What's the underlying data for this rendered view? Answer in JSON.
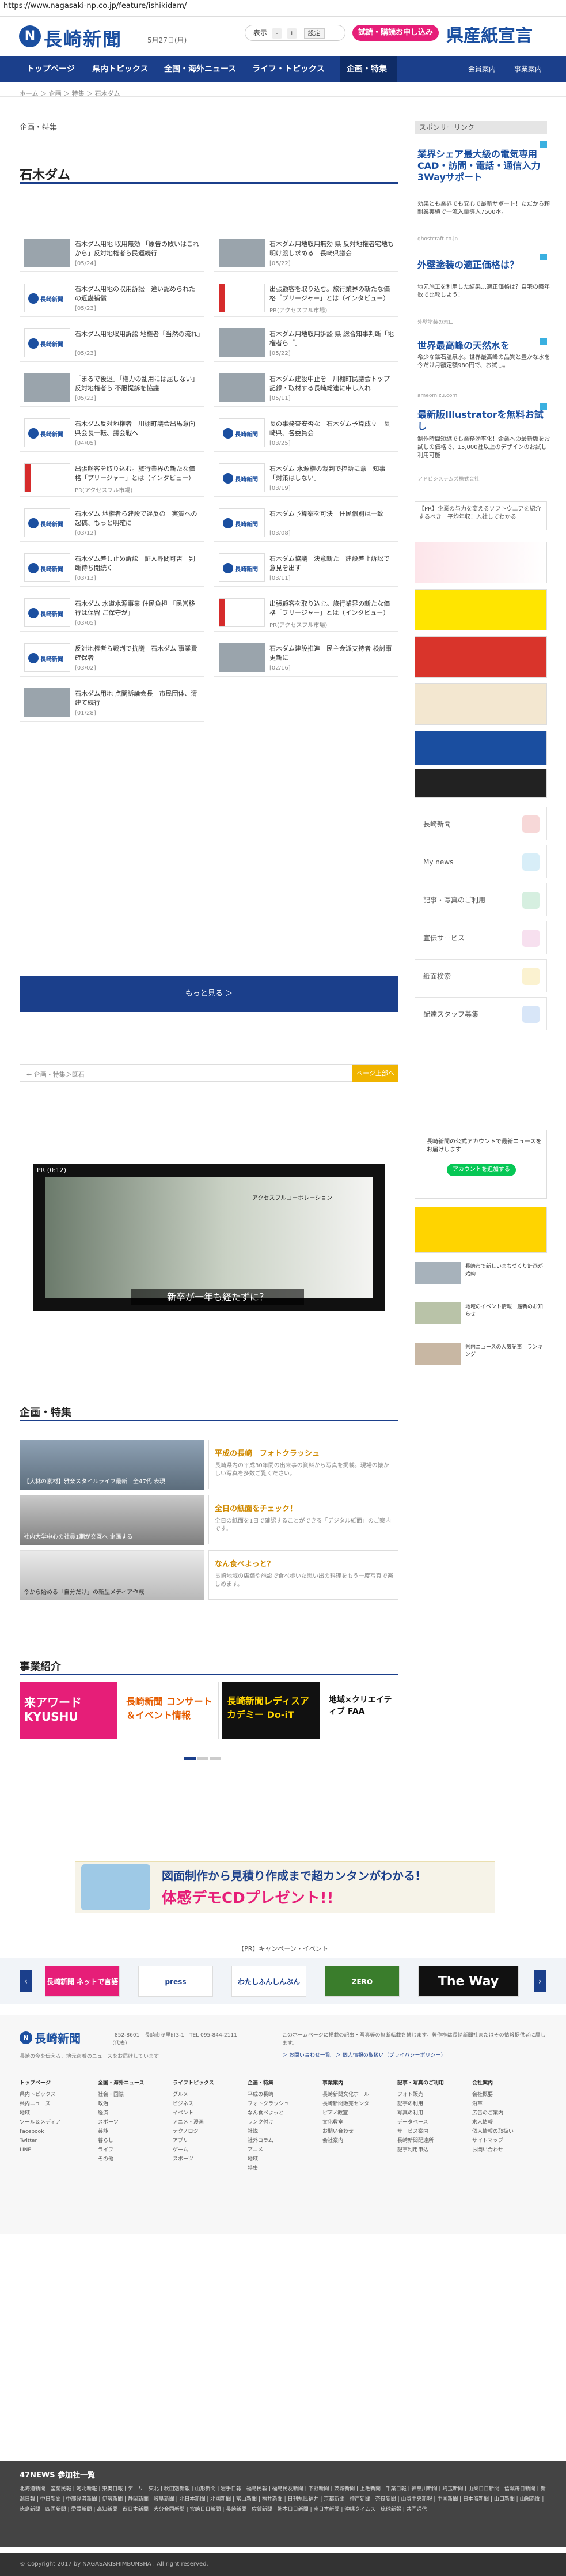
{
  "browser": {
    "url": "https://www.nagasaki-np.co.jp/feature/ishikidam/"
  },
  "header": {
    "logo_text": "長崎新聞",
    "date": "5月27日(月)",
    "font_size_label": "表示",
    "font_size_minus": "-",
    "font_size_plus": "+",
    "font_size_set": "設定",
    "trial_button": "試読・購読お申し込み",
    "ken_logo": "県産紙宣言"
  },
  "nav": {
    "items": [
      "トップページ",
      "県内トピックス",
      "全国・海外ニュース",
      "ライフ・トピックス",
      "企画・特集"
    ],
    "right": [
      "会員案内",
      "事業案内"
    ]
  },
  "breadcrumb": "ホーム ＞ 企画 ＞ 特集 ＞ 石木ダム",
  "main": {
    "label": "企画・特集",
    "title": "石木ダム",
    "articles": [
      {
        "text": "石木ダム用地 収用無効 「原告の敗いはこれから」反対地権者ら民運続行",
        "sub": "[05/24]"
      },
      {
        "text": "石木ダム用地収用無効 県 反対地権者宅地も 明け渡し求める　長崎県議会",
        "sub": "[05/22]"
      },
      {
        "text": "石木ダム用地の収用訴訟　違い認められたの近畿補償",
        "sub": "[05/23]"
      },
      {
        "text": "出張顧客を取り込む。旅行業界の新たな価格「プリージャー」とは（インタビュー）",
        "sub": "PR(アクセスフル市場)"
      },
      {
        "text": "石木ダム用地収用訴訟 地権者「当然の流れ」",
        "sub": "[05/23]"
      },
      {
        "text": "石木ダム用地収用訴訟 県 総合知事判断「地権者ら「」",
        "sub": "[05/22]"
      },
      {
        "text": "「まるで後退」「権力の乱用には屈しない」　反対地権者ら 不服提訴を協議",
        "sub": "[05/23]"
      },
      {
        "text": "石木ダム建設中止を　川棚町民議会トップ記録・取材する長崎総連に申し入れ",
        "sub": "[05/11]"
      },
      {
        "text": "石木ダム反対地権者　川棚町議会出馬意向　県会長一転、議会戦へ",
        "sub": "[04/05]"
      },
      {
        "text": "長の事務査安否な　石木ダム予算成立　長崎県、各委員会",
        "sub": "[03/25]"
      },
      {
        "text": "出張顧客を取り込む。旅行業界の新たな価格「プリージャー」とは（インタビュー）",
        "sub": "PR(アクセスフル市場)"
      },
      {
        "text": "石木ダム 水源権の裁判で控訴に意　知事「対策はしない」",
        "sub": "[03/19]"
      },
      {
        "text": "石木ダム 地権者ら建設で違反の　実質への起稿、もっと明確に",
        "sub": "[03/12]"
      },
      {
        "text": "石木ダム予算案を可決　住民個別は一致",
        "sub": "[03/08]"
      },
      {
        "text": "石木ダム差し止め訴訟　証人尋問可否　判断待ち開続く",
        "sub": "[03/13]"
      },
      {
        "text": "石木ダム協議　決意新た　建設差止訴訟で意見を出す",
        "sub": "[03/11]"
      },
      {
        "text": "石木ダム 水道水源事業 住民負担 「民営移行は保留 ご保守が」",
        "sub": "[03/05]"
      },
      {
        "text": "出張顧客を取り込む。旅行業界の新たな価格「プリージャー」とは（インタビュー）",
        "sub": "PR(アクセスフル市場)"
      },
      {
        "text": "反対地権者ら裁判で抗議　石木ダム 事業費確保者",
        "sub": "[03/02]"
      },
      {
        "text": "石木ダム建設推進　民主会派支持者 検討事　更新に",
        "sub": "[02/16]"
      },
      {
        "text": "石木ダム用地 点閲訴論会長　市民団体、清建て続行",
        "sub": "[01/28]"
      }
    ],
    "more_button": "もっと見る ＞",
    "bottom_crumb": "← 企画・特集＞既石",
    "top_button": "ページ上部へ"
  },
  "video": {
    "pr_label": "PR (0:12)",
    "brand": "アクセスフルコーポレーション",
    "caption": "新卒が一年も経たずに？"
  },
  "feature": {
    "title": "企画・特集",
    "cards": [
      {
        "caption": "【大林の素材】雅楽スタイルライフ最新　全47代 表現"
      },
      {
        "caption": "社内大学中心の社員1期が交互へ 企画する"
      },
      {
        "caption": "今から始める「自分だけ」の新型メディア作戦"
      }
    ],
    "promos": [
      {
        "title": "平成の長崎　フォトクラッシュ",
        "desc": "長崎県内の平成30年間の出来事の資料から写真を掲載。現場の懐かしい写真を多数ご覧ください。"
      },
      {
        "title": "全日の紙面をチェック！",
        "desc": "全日の紙面を1日で確認することができる「デジタル紙面」のご案内です。"
      },
      {
        "title": "なん食べよっと？",
        "desc": "長崎地域の店舗や施設で食べ歩いた思い出の料理をもう一度写真で楽しめます。"
      }
    ]
  },
  "business": {
    "title": "事業紹介",
    "banners": [
      "来アワード KYUSHU",
      "長崎新聞 コンサート＆イベント情報",
      "長崎新聞レディスアカデミー Do-iT",
      "地域×クリエイティブ FAA"
    ]
  },
  "cd_banner": {
    "line1": "図面制作から見積り作成まで超カンタンがわかる!",
    "line2": "体感デモCDプレゼント!!"
  },
  "pr_row": {
    "title": "【PR】キャンペーン・イベント",
    "logos": [
      "長崎新聞 ネットで言語",
      "press",
      "わたしふんしんぶん",
      "ZERO",
      "The Way"
    ]
  },
  "footer": {
    "logo_text": "長崎新聞",
    "address": "〒852-8601　長崎市茂里町3-1　TEL 095-844-2111（代表）",
    "note": "長崎の今を伝える、地元密着のニュースをお届けしています",
    "right_text": "このホームページに掲載の記事・写真等の無断転載を禁じます。著作権は長崎新聞社またはその情報提供者に属します。",
    "right_link": "＞ お問い合わせ一覧　＞ 個人情報の取扱い（プライバシーポリシー）",
    "columns": [
      {
        "head": "トップページ",
        "items": [
          "県内トピックス",
          "県内ニュース",
          "地域",
          "ツール＆メディア",
          "Facebook",
          "Twitter",
          "LINE"
        ]
      },
      {
        "head": "全国・海外ニュース",
        "items": [
          "社会・国際",
          "政治",
          "経済",
          "スポーツ",
          "芸能",
          "暮らし",
          "ライフ",
          "その他"
        ]
      },
      {
        "head": "ライフトピックス",
        "items": [
          "グルメ",
          "ビジネス",
          "イベント",
          "アニメ・漫画",
          "テクノロジー",
          "アプリ",
          "ゲーム",
          "スポーツ"
        ]
      },
      {
        "head": "企画・特集",
        "items": [
          "平成の長崎",
          "フォトクラッシュ",
          "なん食べよっと",
          "ランク付け",
          "社説",
          "社外コラム",
          "アニメ",
          "地域",
          "特集"
        ]
      },
      {
        "head": "事業案内",
        "items": [
          "長崎新聞文化ホール",
          "長崎新聞販売センター",
          "ピアノ教室",
          "文化教室",
          "お問い合わせ",
          "会社案内"
        ]
      },
      {
        "head": "記事・写真のご利用",
        "items": [
          "フォト販売",
          "記事の利用",
          "写真の利用",
          "データベース",
          "サービス案内",
          "長崎新聞配達所",
          "記事利用申込"
        ]
      },
      {
        "head": "会社案内",
        "items": [
          "会社概要",
          "沿革",
          "広告のご案内",
          "求人情報",
          "個人情報の取扱い",
          "サイトマップ",
          "お問い合わせ"
        ]
      }
    ]
  },
  "news47": {
    "title": "47NEWS 参加社一覧",
    "links": "北海道新聞 | 室蘭民報 | 河北新報 | 東奥日報 | デーリー東北 | 秋田魁新報 | 山形新聞 | 岩手日報 | 福島民報 | 福島民友新聞 | 下野新聞 | 茨城新聞 | 上毛新聞 | 千葉日報 | 神奈川新聞 | 埼玉新聞 | 山梨日日新聞 | 信濃毎日新聞 | 新潟日報 | 中日新聞 | 中部経済新聞 | 伊勢新聞 | 静岡新聞 | 岐阜新聞 | 北日本新聞 | 北國新聞 | 富山新聞 | 福井新聞 | 日刊県民福井 | 京都新聞 | 神戸新聞 | 奈良新聞 | 山陰中央新報 | 中国新聞 | 日本海新聞 | 山口新聞 | 山陽新聞 | 徳島新聞 | 四国新聞 | 愛媛新聞 | 高知新聞 | 西日本新聞 | 大分合同新聞 | 宮崎日日新聞 | 長崎新聞 | 佐賀新聞 | 熊本日日新聞 | 南日本新聞 | 沖縄タイムス | 琉球新報 | 共同通信"
  },
  "copyright": "© Copyright 2017 by NAGASAKISHIMBUNSHA . All right reserved.",
  "sidebar": {
    "sponsor": "スポンサーリンク",
    "ads": [
      {
        "title": "業界シェア最大級の電気専用CAD・訪問・電話・通信入力3Wayサポート",
        "desc": "効果とも業界でも安心で最新サポート！ただから頼耐業実績で一流入量導入7500本。",
        "src": "ghostcraft.co.jp"
      },
      {
        "title": "外壁塗装の適正価格は？",
        "desc": "地元施工を利用した結果…適正価格は？自宅の築年数で比較しよう！",
        "src": "外壁塗装の窓口"
      },
      {
        "title": "世界最高峰の天然水を",
        "desc": "希少な鉱石温泉水。世界最高峰の品質と豊かな水を今だけ月額定額980円で、お試し。",
        "src": "ameomizu.com"
      },
      {
        "title": "最新版Illustratorを無料お試し",
        "desc": "制作時間短縮でも業務効率化！企業への最新版をお試しの価格で、15,000社以上のデザインのお試し利用可能",
        "src": "アドビシステムズ株式会社"
      }
    ],
    "text_box": "【PR】企業の与力を変えるソフトウエアを紹介するべき　平均年収！入社してわかる",
    "menu": [
      "長崎新聞",
      "My news",
      "記事・写真のご利用",
      "宣伝サービス",
      "紙面検索",
      "配達スタッフ募集"
    ],
    "line_text": "長崎新聞の公式アカウントで最新ニュースをお届けします",
    "line_button": "アカウントを追加する",
    "side_list": [
      {
        "text": "長崎市で新しいまちづくり計画が始動"
      },
      {
        "text": "地域のイベント情報　最新のお知らせ"
      },
      {
        "text": "県内ニュースの人気記事　ランキング"
      }
    ]
  }
}
